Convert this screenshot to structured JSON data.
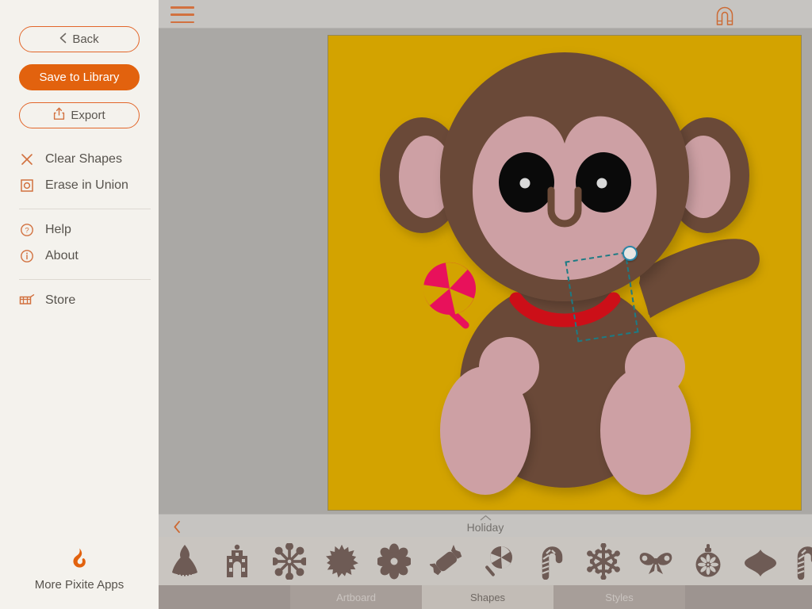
{
  "sidebar": {
    "back_label": "Back",
    "save_label": "Save to Library",
    "export_label": "Export",
    "menu": [
      {
        "label": "Clear Shapes",
        "icon": "close-x-icon"
      },
      {
        "label": "Erase in Union",
        "icon": "erase-union-icon"
      },
      {
        "label": "Help",
        "icon": "question-circle-icon"
      },
      {
        "label": "About",
        "icon": "info-circle-icon"
      },
      {
        "label": "Store",
        "icon": "shopping-cart-icon"
      }
    ],
    "footer_label": "More Pixite Apps",
    "footer_icon": "pixite-flame-logo"
  },
  "topbar": {
    "menu_icon": "hamburger-menu-icon",
    "snap_icon": "magnet-snap-icon"
  },
  "canvas": {
    "background_color": "#d3a300",
    "artwork": "monkey-holding-lollipop",
    "colors": {
      "fur_dark": "#6b4a38",
      "fur_light": "#cda0a4",
      "mouth_red": "#cc0f18",
      "eye_black": "#0a0a0a",
      "eye_glint": "#d9d9d9",
      "lollipop_pink": "#e8115b",
      "lollipop_accent": "#d3a300"
    },
    "selection": {
      "selected_shape": "lollipop",
      "handle_color": "#2a86a8",
      "box_color": "#1c7b84"
    }
  },
  "drawer": {
    "back_icon": "chevron-left-icon",
    "collapse_icon": "chevron-up-icon",
    "category_title": "Holiday",
    "shapes": [
      {
        "name": "shape-angel"
      },
      {
        "name": "shape-church"
      },
      {
        "name": "shape-snowflake-star"
      },
      {
        "name": "shape-starburst"
      },
      {
        "name": "shape-flower-gear"
      },
      {
        "name": "shape-wrapped-candy"
      },
      {
        "name": "shape-pinwheel-lollipop"
      },
      {
        "name": "shape-candy-cane"
      },
      {
        "name": "shape-snowflake"
      },
      {
        "name": "shape-bow"
      },
      {
        "name": "shape-ornament-round"
      },
      {
        "name": "shape-ornament-teardrop"
      },
      {
        "name": "shape-candy-cane-partial"
      }
    ]
  },
  "tabs": [
    {
      "id": "spacer-left",
      "label": ""
    },
    {
      "id": "artboard",
      "label": "Artboard",
      "selected": false
    },
    {
      "id": "shapes",
      "label": "Shapes",
      "selected": true
    },
    {
      "id": "styles",
      "label": "Styles",
      "selected": false
    },
    {
      "id": "spacer-right",
      "label": ""
    }
  ]
}
